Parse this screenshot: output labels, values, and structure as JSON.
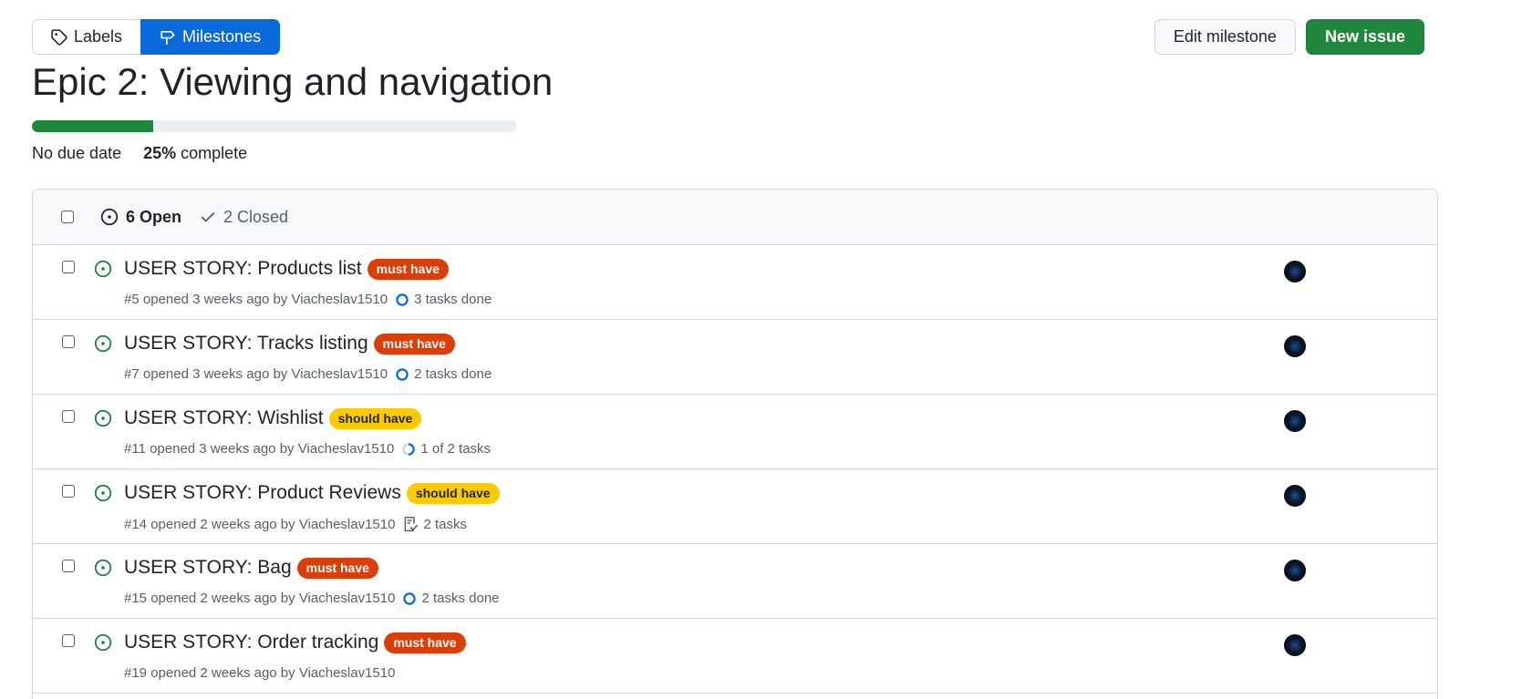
{
  "nav": {
    "labels_label": "Labels",
    "milestones_label": "Milestones"
  },
  "actions": {
    "edit_label": "Edit milestone",
    "new_issue_label": "New issue"
  },
  "milestone": {
    "title": "Epic 2: Viewing and navigation",
    "due": "No due date",
    "percent": "25%",
    "complete_text": "complete",
    "progress_fraction": 0.25
  },
  "filters": {
    "open_label": "6 Open",
    "closed_label": "2 Closed"
  },
  "issues": [
    {
      "title": "USER STORY: Products list",
      "label": "must have",
      "meta": "#5 opened 3 weeks ago by Viacheslav1510",
      "tasks": "3 tasks done"
    },
    {
      "title": "USER STORY: Tracks listing",
      "label": "must have",
      "meta": "#7 opened 3 weeks ago by Viacheslav1510",
      "tasks": "2 tasks done"
    },
    {
      "title": "USER STORY: Wishlist",
      "label": "should have",
      "meta": "#11 opened 3 weeks ago by Viacheslav1510",
      "tasks": "1 of 2 tasks"
    },
    {
      "title": "USER STORY: Product Reviews",
      "label": "should have",
      "meta": "#14 opened 2 weeks ago by Viacheslav1510",
      "tasks": "2 tasks"
    },
    {
      "title": "USER STORY: Bag",
      "label": "must have",
      "meta": "#15 opened 2 weeks ago by Viacheslav1510",
      "tasks": "2 tasks done"
    },
    {
      "title": "USER STORY: Order tracking",
      "label": "must have",
      "meta": "#19 opened 2 weeks ago by Viacheslav1510",
      "tasks": ""
    }
  ],
  "colors": {
    "primary_blue": "#0969da",
    "success_green": "#1f883d",
    "must_have": "#d93f0b",
    "should_have": "#fbca04"
  }
}
